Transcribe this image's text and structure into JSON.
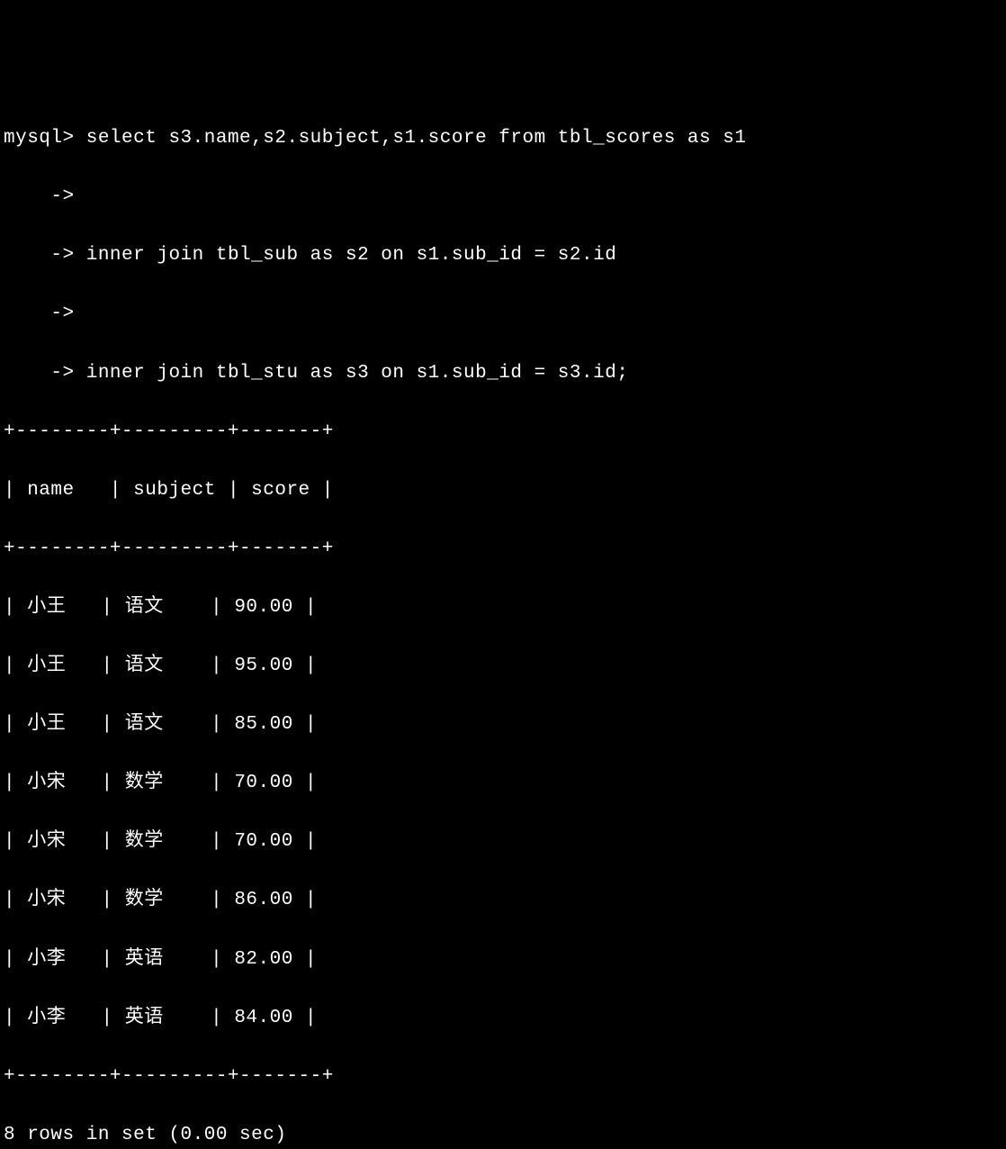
{
  "terminal": {
    "prompt": "mysql>",
    "continuation": "    ->",
    "query_line1": " select s3.name,s2.subject,s1.score from tbl_scores as s1",
    "query_line2": "",
    "query_line3": " inner join tbl_sub as s2 on s1.sub_id = s2.id",
    "query_line4": "",
    "query_line5": " inner join tbl_stu as s3 on s1.sub_id = s3.id;",
    "border": "+--------+---------+-------+",
    "header": "| name   | subject | score |",
    "rows": [
      "| 小王   | 语文    | 90.00 |",
      "| 小王   | 语文    | 95.00 |",
      "| 小王   | 语文    | 85.00 |",
      "| 小宋   | 数学    | 70.00 |",
      "| 小宋   | 数学    | 70.00 |",
      "| 小宋   | 数学    | 86.00 |",
      "| 小李   | 英语    | 82.00 |",
      "| 小李   | 英语    | 84.00 |"
    ],
    "footer": "8 rows in set (0.00 sec)"
  },
  "table_data": {
    "columns": [
      "name",
      "subject",
      "score"
    ],
    "data": [
      {
        "name": "小王",
        "subject": "语文",
        "score": "90.00"
      },
      {
        "name": "小王",
        "subject": "语文",
        "score": "95.00"
      },
      {
        "name": "小王",
        "subject": "语文",
        "score": "85.00"
      },
      {
        "name": "小宋",
        "subject": "数学",
        "score": "70.00"
      },
      {
        "name": "小宋",
        "subject": "数学",
        "score": "70.00"
      },
      {
        "name": "小宋",
        "subject": "数学",
        "score": "86.00"
      },
      {
        "name": "小李",
        "subject": "英语",
        "score": "82.00"
      },
      {
        "name": "小李",
        "subject": "英语",
        "score": "84.00"
      }
    ]
  }
}
